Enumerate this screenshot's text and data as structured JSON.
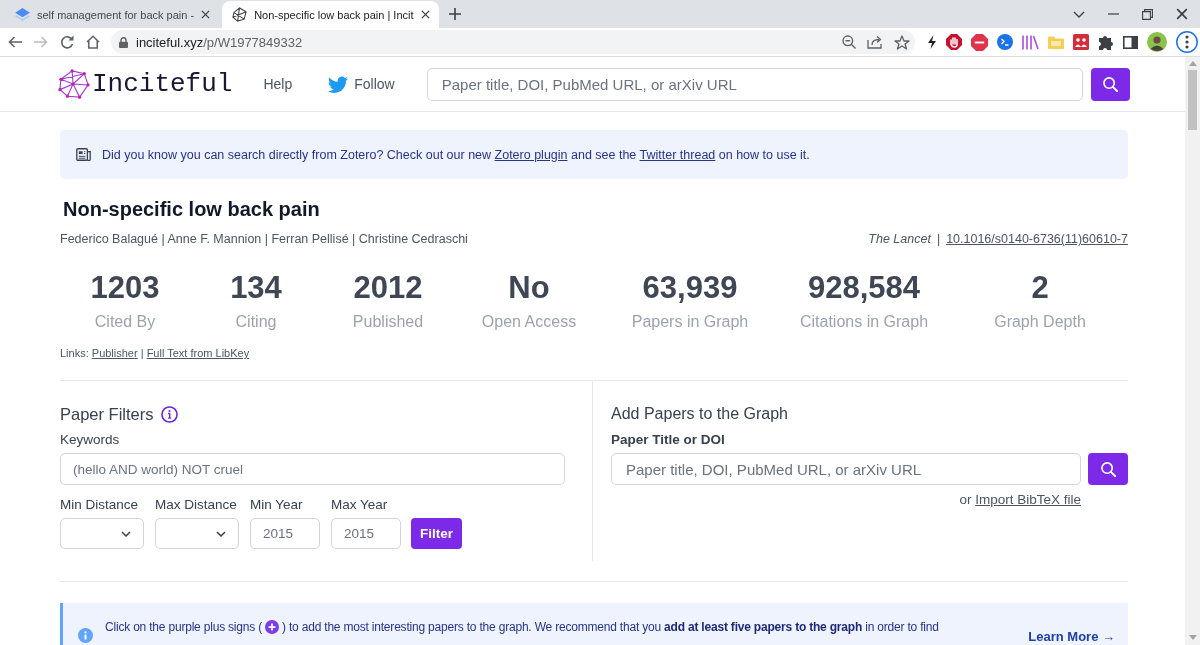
{
  "browser": {
    "tabs": [
      {
        "title": "self management for back pain -",
        "selected": false
      },
      {
        "title": "Non-specific low back pain | Incit",
        "selected": true
      }
    ],
    "nav_buttons": [
      {
        "kind": "back",
        "disabled": false
      },
      {
        "kind": "forward",
        "disabled": true
      },
      {
        "kind": "reload",
        "disabled": false
      },
      {
        "kind": "home",
        "disabled": false
      }
    ],
    "url": {
      "host": "inciteful.xyz",
      "path": "/p/W1977849332"
    }
  },
  "header": {
    "logo": "Inciteful",
    "nav": [
      {
        "kind": "link",
        "text": "Help"
      },
      {
        "kind": "twitter",
        "text": "Follow"
      }
    ],
    "search": {
      "placeholder": "Paper title, DOI, PubMed URL, or arXiv URL"
    }
  },
  "notice": {
    "parts": [
      {
        "kind": "text",
        "text": "Did you know you can search directly from Zotero? Check out our new "
      },
      {
        "kind": "link",
        "text": "Zotero plugin"
      },
      {
        "kind": "text",
        "text": " and see the "
      },
      {
        "kind": "link",
        "text": "Twitter thread"
      },
      {
        "kind": "text",
        "text": " on how to use it."
      }
    ]
  },
  "paper": {
    "title": "Non-specific low back pain",
    "authors": "Federico Balagué | Anne F. Mannion | Ferran Pellisé | Christine Cedraschi",
    "journal": "The Lancet",
    "separator": "|",
    "doi": "10.1016/s0140-6736(11)60610-7",
    "stats": [
      {
        "value": "1203",
        "label": "Cited By"
      },
      {
        "value": "134",
        "label": "Citing"
      },
      {
        "value": "2012",
        "label": "Published"
      },
      {
        "value": "No",
        "label": "Open Access"
      },
      {
        "value": "63,939",
        "label": "Papers in Graph"
      },
      {
        "value": "928,584",
        "label": "Citations in Graph"
      },
      {
        "value": "2",
        "label": "Graph Depth"
      }
    ],
    "links": {
      "label": "Links:",
      "items": [
        "Publisher",
        "Full Text from LibKey"
      ],
      "separator": "|"
    }
  },
  "filters": {
    "title": "Paper Filters",
    "keywords": {
      "label": "Keywords",
      "placeholder": "(hello AND world) NOT cruel"
    },
    "fields": [
      {
        "kind": "select",
        "label": "Min Distance"
      },
      {
        "kind": "select",
        "label": "Max Distance"
      },
      {
        "kind": "number",
        "label": "Min Year",
        "placeholder": "2015"
      },
      {
        "kind": "number",
        "label": "Max Year",
        "placeholder": "2015"
      }
    ],
    "button": "Filter"
  },
  "add_papers": {
    "title": "Add Papers to the Graph",
    "field": {
      "label": "Paper Title or DOI",
      "placeholder": "Paper title, DOI, PubMed URL, or arXiv URL"
    },
    "import": {
      "prefix": "or",
      "link": "Import BibTeX file"
    }
  },
  "callout": {
    "parts": [
      {
        "kind": "text",
        "text": "Click on the purple plus signs ("
      },
      {
        "kind": "icon"
      },
      {
        "kind": "text",
        "text": ") to add the most interesting papers to the graph. We recommend that you **add at least five papers to the graph** in order to find"
      }
    ],
    "learn_more": "Learn More →"
  }
}
